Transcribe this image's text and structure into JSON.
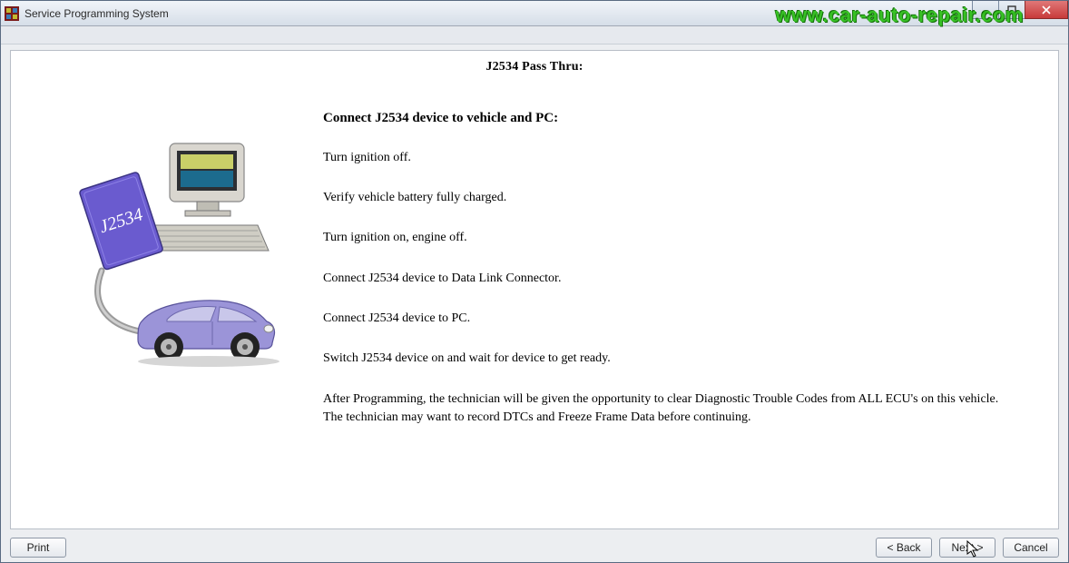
{
  "window": {
    "title": "Service Programming System"
  },
  "watermark": "www.car-auto-repair.com",
  "content": {
    "header": "J2534 Pass Thru:",
    "lead": "Connect J2534 device to vehicle and PC:",
    "steps": [
      "Turn ignition off.",
      "Verify vehicle battery fully charged.",
      "Turn ignition on, engine off.",
      "Connect J2534 device to Data Link Connector.",
      "Connect J2534 device to PC.",
      "Switch J2534 device on and wait for device to get ready."
    ],
    "note": "After Programming, the technician will be given the opportunity to clear Diagnostic Trouble Codes from ALL ECU's on this vehicle. The technician may want to record DTCs and Freeze Frame Data before continuing."
  },
  "illustration": {
    "device_label": "J2534"
  },
  "buttons": {
    "print": "Print",
    "back": "< Back",
    "next": "Next >",
    "cancel": "Cancel"
  }
}
